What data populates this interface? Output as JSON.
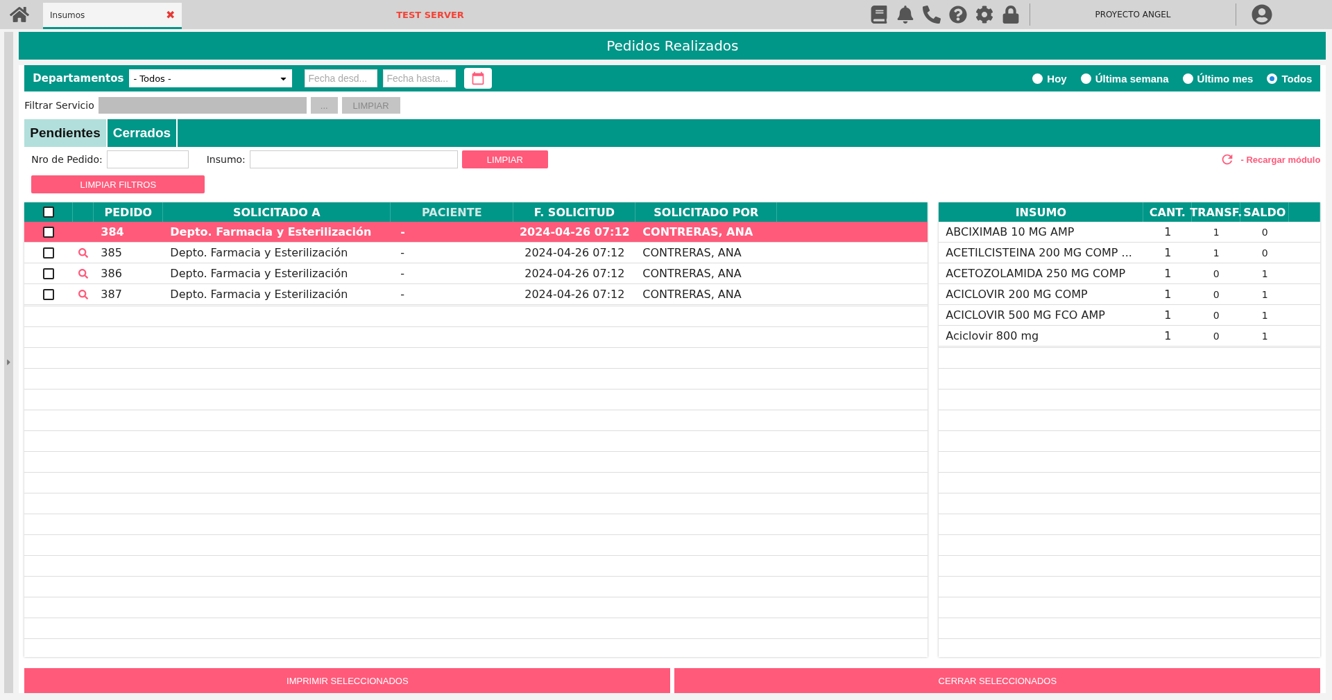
{
  "top_bar": {
    "tab": {
      "label": "Insumos",
      "close": "✖"
    },
    "server": "TEST SERVER",
    "project": "PROYECTO ANGEL"
  },
  "title": "Pedidos Realizados",
  "filter_bar": {
    "departamentos_label": "Departamentos",
    "departamento": "- Todos -",
    "fecha_desde": {
      "placeholder": "Fecha desd..."
    },
    "fecha_hasta": {
      "placeholder": "Fecha hasta..."
    },
    "periods": [
      {
        "label": "Hoy",
        "selected": false
      },
      {
        "label": "Última semana",
        "selected": false
      },
      {
        "label": "Último mes",
        "selected": false
      },
      {
        "label": "Todos",
        "selected": true
      }
    ]
  },
  "servicio": {
    "label": "Filtrar Servicio",
    "browse": "...",
    "clear": "LIMPIAR"
  },
  "tabs": [
    {
      "label": "Pendientes",
      "selected": true
    },
    {
      "label": "Cerrados",
      "selected": false
    }
  ],
  "filters": {
    "pedido_label": "Nro de Pedido:",
    "insumo_label": "Insumo:",
    "clear": "LIMPIAR",
    "clear_all": "LIMPIAR FILTROS",
    "reload": "- Recargar módulo"
  },
  "orders": {
    "header_checked": false,
    "columns": [
      "PEDIDO",
      "SOLICITADO A",
      "PACIENTE",
      "F. SOLICITUD",
      "SOLICITADO POR"
    ],
    "rows": [
      {
        "pedido": "384",
        "solicitado_a": "Depto. Farmacia y Esterilización",
        "paciente": "-",
        "fecha": "2024-04-26 07:12",
        "solicitado_por": "CONTRERAS, ANA",
        "selected": true,
        "checked": false,
        "view_icon": false
      },
      {
        "pedido": "385",
        "solicitado_a": "Depto. Farmacia y Esterilización",
        "paciente": "-",
        "fecha": "2024-04-26 07:12",
        "solicitado_por": "CONTRERAS, ANA",
        "selected": false,
        "checked": false,
        "view_icon": true
      },
      {
        "pedido": "386",
        "solicitado_a": "Depto. Farmacia y Esterilización",
        "paciente": "-",
        "fecha": "2024-04-26 07:12",
        "solicitado_por": "CONTRERAS, ANA",
        "selected": false,
        "checked": false,
        "view_icon": true
      },
      {
        "pedido": "387",
        "solicitado_a": "Depto. Farmacia y Esterilización",
        "paciente": "-",
        "fecha": "2024-04-26 07:12",
        "solicitado_por": "CONTRERAS, ANA",
        "selected": false,
        "checked": false,
        "view_icon": true
      }
    ]
  },
  "items": {
    "columns": [
      "INSUMO",
      "CANT.",
      "TRANSF.",
      "SALDO"
    ],
    "rows": [
      [
        "ABCIXIMAB 10 MG AMP",
        "1",
        "1",
        "0"
      ],
      [
        "ACETILCISTEINA 200 MG COMP ...",
        "1",
        "1",
        "0"
      ],
      [
        "ACETOZOLAMIDA 250 MG COMP",
        "1",
        "0",
        "1"
      ],
      [
        "ACICLOVIR 200 MG COMP",
        "1",
        "0",
        "1"
      ],
      [
        "ACICLOVIR 500 MG  FCO AMP",
        "1",
        "0",
        "1"
      ],
      [
        "Aciclovir 800 mg",
        "1",
        "0",
        "1"
      ]
    ]
  },
  "actions": [
    "IMPRIMIR SELECCIONADOS",
    "CERRAR SELECCIONADOS"
  ]
}
